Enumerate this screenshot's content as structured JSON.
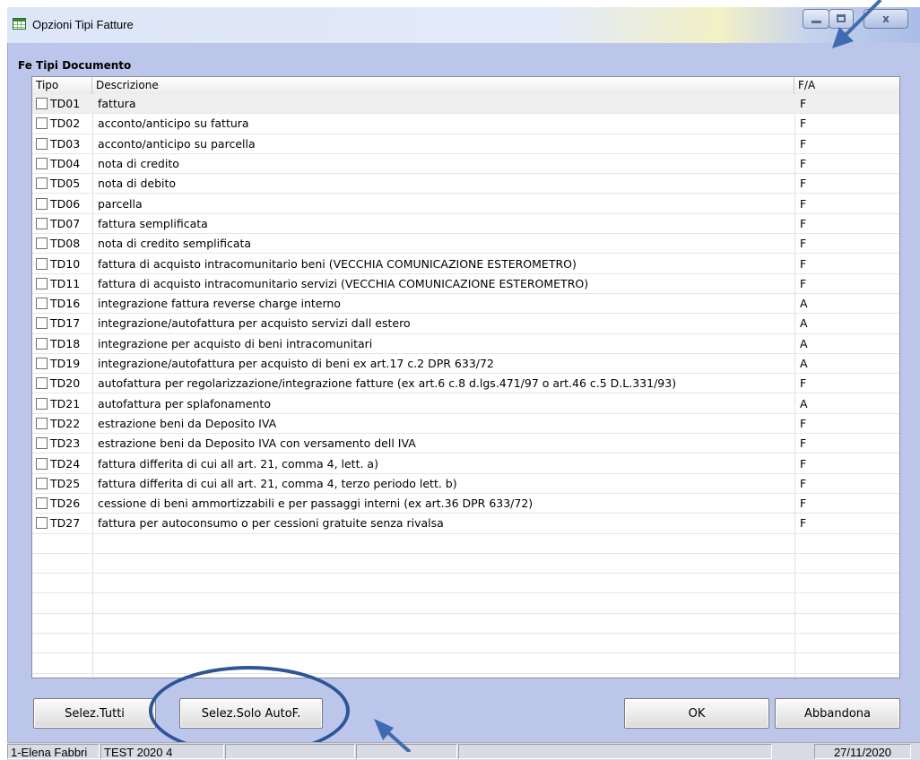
{
  "window": {
    "title": "Opzioni Tipi Fatture",
    "section_title": "Fe Tipi Documento"
  },
  "grid": {
    "columns": [
      "Tipo",
      "Descrizione",
      "F/A"
    ],
    "rows": [
      {
        "code": "TD01",
        "desc": "fattura",
        "fa": "F"
      },
      {
        "code": "TD02",
        "desc": "acconto/anticipo su fattura",
        "fa": "F"
      },
      {
        "code": "TD03",
        "desc": "acconto/anticipo su parcella",
        "fa": "F"
      },
      {
        "code": "TD04",
        "desc": "nota di credito",
        "fa": "F"
      },
      {
        "code": "TD05",
        "desc": "nota di debito",
        "fa": "F"
      },
      {
        "code": "TD06",
        "desc": "parcella",
        "fa": "F"
      },
      {
        "code": "TD07",
        "desc": "fattura semplificata",
        "fa": "F"
      },
      {
        "code": "TD08",
        "desc": "nota di credito semplificata",
        "fa": "F"
      },
      {
        "code": "TD10",
        "desc": "fattura di acquisto intracomunitario beni (VECCHIA COMUNICAZIONE ESTEROMETRO)",
        "fa": "F"
      },
      {
        "code": "TD11",
        "desc": "fattura di acquisto intracomunitario servizi (VECCHIA COMUNICAZIONE ESTEROMETRO)",
        "fa": "F"
      },
      {
        "code": "TD16",
        "desc": "integrazione fattura reverse charge interno",
        "fa": "A"
      },
      {
        "code": "TD17",
        "desc": "integrazione/autofattura per acquisto servizi dall estero",
        "fa": "A"
      },
      {
        "code": "TD18",
        "desc": "integrazione per acquisto di beni intracomunitari",
        "fa": "A"
      },
      {
        "code": "TD19",
        "desc": "integrazione/autofattura per acquisto di beni ex art.17 c.2 DPR 633/72",
        "fa": "A"
      },
      {
        "code": "TD20",
        "desc": "autofattura per regolarizzazione/integrazione fatture (ex art.6 c.8 d.lgs.471/97 o art.46 c.5 D.L.331/93)",
        "fa": "F"
      },
      {
        "code": "TD21",
        "desc": "autofattura per splafonamento",
        "fa": "A"
      },
      {
        "code": "TD22",
        "desc": "estrazione beni da Deposito IVA",
        "fa": "F"
      },
      {
        "code": "TD23",
        "desc": "estrazione beni da Deposito IVA con versamento dell IVA",
        "fa": "F"
      },
      {
        "code": "TD24",
        "desc": "fattura differita di cui all art. 21, comma 4, lett. a)",
        "fa": "F"
      },
      {
        "code": "TD25",
        "desc": "fattura differita di cui all art. 21, comma 4, terzo periodo lett. b)",
        "fa": "F"
      },
      {
        "code": "TD26",
        "desc": "cessione di beni ammortizzabili e per passaggi interni (ex art.36 DPR 633/72)",
        "fa": "F"
      },
      {
        "code": "TD27",
        "desc": "fattura per autoconsumo o per cessioni gratuite senza rivalsa",
        "fa": "F"
      }
    ]
  },
  "buttons": {
    "select_all": "Selez.Tutti",
    "select_autof": "Selez.Solo AutoF.",
    "ok": "OK",
    "cancel": "Abbandona"
  },
  "statusbar": {
    "user": "1-Elena Fabbri",
    "db": "TEST 2020 4",
    "date": "27/11/2020"
  },
  "colors": {
    "window_bg": "#bcc6ea",
    "annotation": "#2e5597"
  },
  "icons": [
    "app-table-icon",
    "minimize-icon",
    "maximize-icon",
    "close-icon",
    "arrow-annotation-icon"
  ]
}
